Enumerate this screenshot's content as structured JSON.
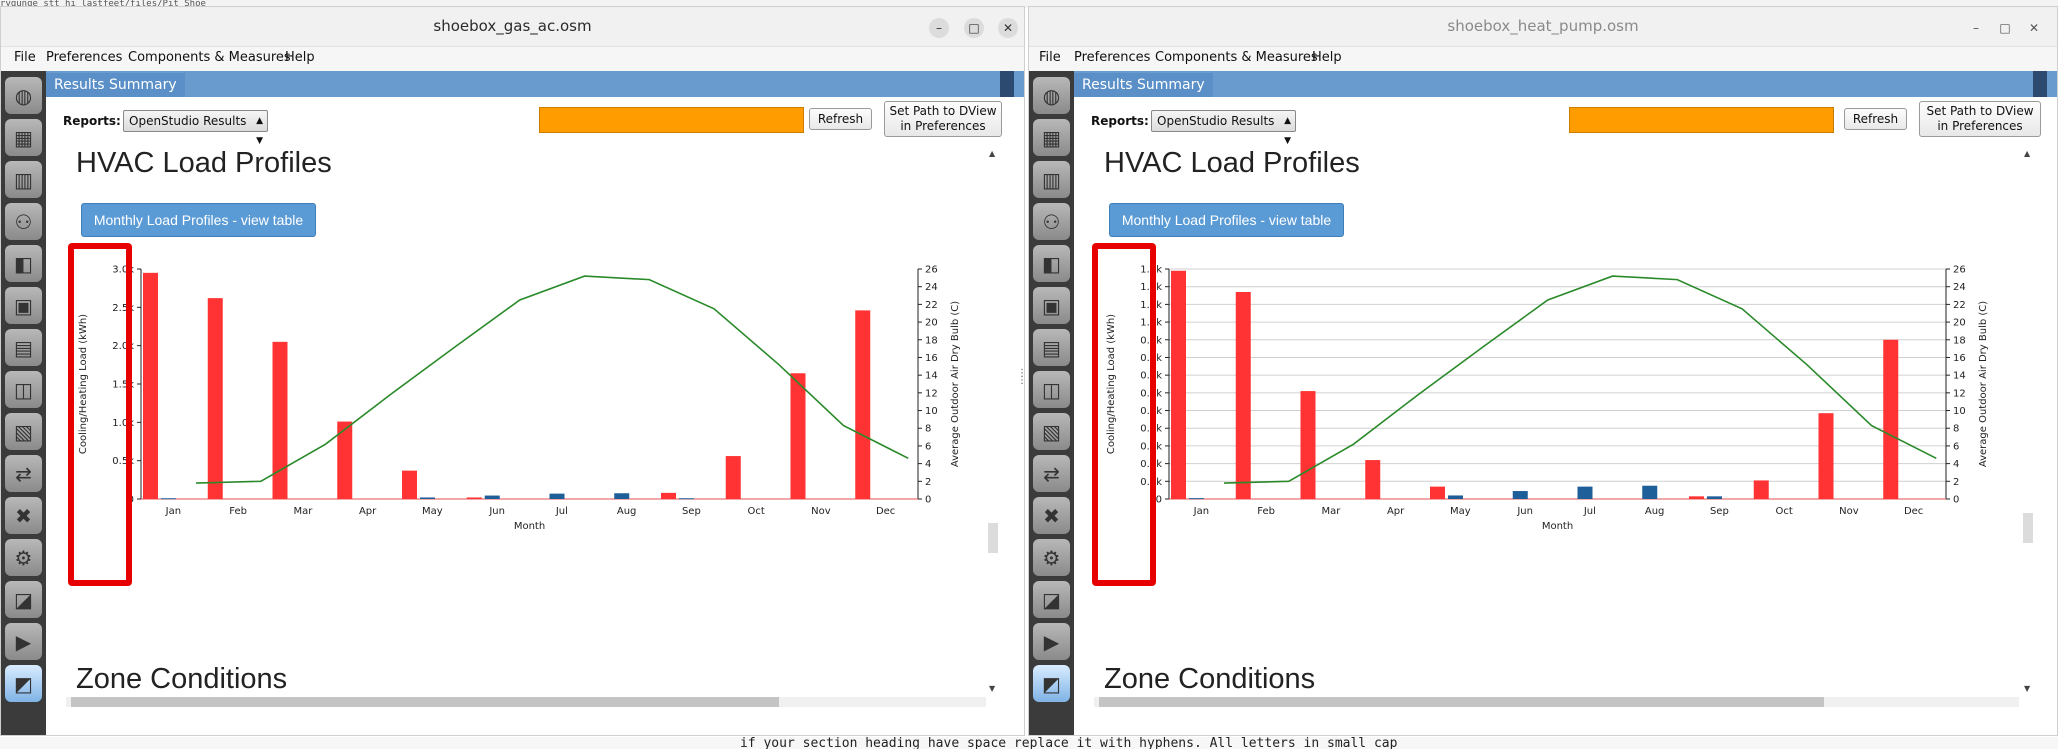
{
  "background": {
    "top_text": "rygunge stt hi lastfeet/files/Pit Shoe",
    "bottom_text": "if your section heading have space replace it with hyphens. All letters in small cap"
  },
  "windows": [
    {
      "title": "shoebox_gas_ac.osm",
      "menu": [
        "File",
        "Preferences",
        "Components & Measures",
        "Help"
      ],
      "tab_label": "Results Summary",
      "reports_label": "Reports:",
      "reports_value": "OpenStudio Results",
      "refresh_label": "Refresh",
      "dview_label_1": "Set Path to DView",
      "dview_label_2": "in Preferences",
      "section_title": "HVAC Load Profiles",
      "view_table_label": "Monthly Load Profiles - view table",
      "next_section_title": "Zone Conditions",
      "chart_data": {
        "type": "bar",
        "xlabel": "Month",
        "ylabel": "Cooling/Heating Load (kWh)",
        "y2label": "Average Outdoor Air Dry Bulb (C)",
        "categories": [
          "Jan",
          "Feb",
          "Mar",
          "Apr",
          "May",
          "Jun",
          "Jul",
          "Aug",
          "Sep",
          "Oct",
          "Nov",
          "Dec"
        ],
        "ylim": [
          0,
          3000
        ],
        "y_ticks": [
          "0",
          "0.5k",
          "1.0k",
          "1.5k",
          "2.0k",
          "2.5k",
          "3.0k"
        ],
        "y_tick_values": [
          0,
          500,
          1000,
          1500,
          2000,
          2500,
          3000
        ],
        "y2lim": [
          0,
          26
        ],
        "y2_ticks": [
          "0",
          "2",
          "4",
          "6",
          "8",
          "10",
          "12",
          "14",
          "16",
          "18",
          "20",
          "22",
          "24",
          "26"
        ],
        "grid": false,
        "series": [
          {
            "values": [
              2950,
              2620,
              2050,
              1010,
              370,
              20,
              0,
              0,
              80,
              560,
              1640,
              2460
            ],
            "color": "#ff3333"
          },
          {
            "values": [
              10,
              0,
              0,
              0,
              20,
              45,
              70,
              75,
              10,
              0,
              0,
              0
            ],
            "color": "#1f5f99"
          },
          {
            "values": [
              null,
              1.8,
              2.0,
              6.2,
              11.8,
              17.2,
              22.5,
              25.2,
              24.8,
              21.5,
              15.2,
              8.3,
              4.6
            ],
            "color": "#2a8a2a"
          }
        ],
        "temperature_x_positions": "between categories",
        "temperature": [
          1.8,
          2.0,
          6.2,
          11.8,
          17.2,
          22.5,
          25.2,
          24.8,
          21.5,
          15.2,
          8.3,
          4.6
        ]
      }
    },
    {
      "title": "shoebox_heat_pump.osm",
      "menu": [
        "File",
        "Preferences",
        "Components & Measures",
        "Help"
      ],
      "tab_label": "Results Summary",
      "reports_label": "Reports:",
      "reports_value": "OpenStudio Results",
      "refresh_label": "Refresh",
      "dview_label_1": "Set Path to DView",
      "dview_label_2": "in Preferences",
      "section_title": "HVAC Load Profiles",
      "view_table_label": "Monthly Load Profiles - view table",
      "next_section_title": "Zone Conditions",
      "chart_data": {
        "type": "bar",
        "xlabel": "Month",
        "ylabel": "Cooling/Heating Load (kWh)",
        "y2label": "Average Outdoor Air Dry Bulb (C)",
        "categories": [
          "Jan",
          "Feb",
          "Mar",
          "Apr",
          "May",
          "Jun",
          "Jul",
          "Aug",
          "Sep",
          "Oct",
          "Nov",
          "Dec"
        ],
        "ylim": [
          0,
          1300
        ],
        "y_ticks": [
          "0",
          "0.1k",
          "0.2k",
          "0.3k",
          "0.4k",
          "0.5k",
          "0.6k",
          "0.7k",
          "0.8k",
          "0.9k",
          "1.0k",
          "1.1k",
          "1.2k",
          "1.3k"
        ],
        "y_tick_values": [
          0,
          100,
          200,
          300,
          400,
          500,
          600,
          700,
          800,
          900,
          1000,
          1100,
          1200,
          1300
        ],
        "y2lim": [
          0,
          26
        ],
        "y2_ticks": [
          "0",
          "2",
          "4",
          "6",
          "8",
          "10",
          "12",
          "14",
          "16",
          "18",
          "20",
          "22",
          "24",
          "26"
        ],
        "grid": true,
        "series": [
          {
            "values": [
              1290,
              1170,
              610,
              220,
              70,
              0,
              0,
              0,
              15,
              105,
              485,
              900
            ],
            "color": "#ff3333"
          },
          {
            "values": [
              5,
              0,
              0,
              0,
              20,
              45,
              70,
              75,
              15,
              0,
              0,
              0
            ],
            "color": "#1f5f99"
          }
        ],
        "temperature": [
          1.8,
          2.0,
          6.2,
          11.8,
          17.2,
          22.5,
          25.2,
          24.8,
          21.5,
          15.2,
          8.3,
          4.6
        ]
      }
    }
  ],
  "colors": {
    "heating": "#ff3333",
    "cooling": "#1f5f99",
    "temperature": "#2a8a2a",
    "highlight": "#e60000",
    "orange": "#ff9d00",
    "tab_blue": "#6a9bcf"
  },
  "sidebar_icons": [
    "site-icon",
    "schedules-icon",
    "constructions-icon",
    "loads-icon",
    "space-types-icon",
    "geometry-icon",
    "facility-icon",
    "spaces-icon",
    "thermal-zones-icon",
    "hvac-systems-icon",
    "variables-icon",
    "simulation-settings-icon",
    "measures-icon",
    "run-icon",
    "results-icon"
  ]
}
